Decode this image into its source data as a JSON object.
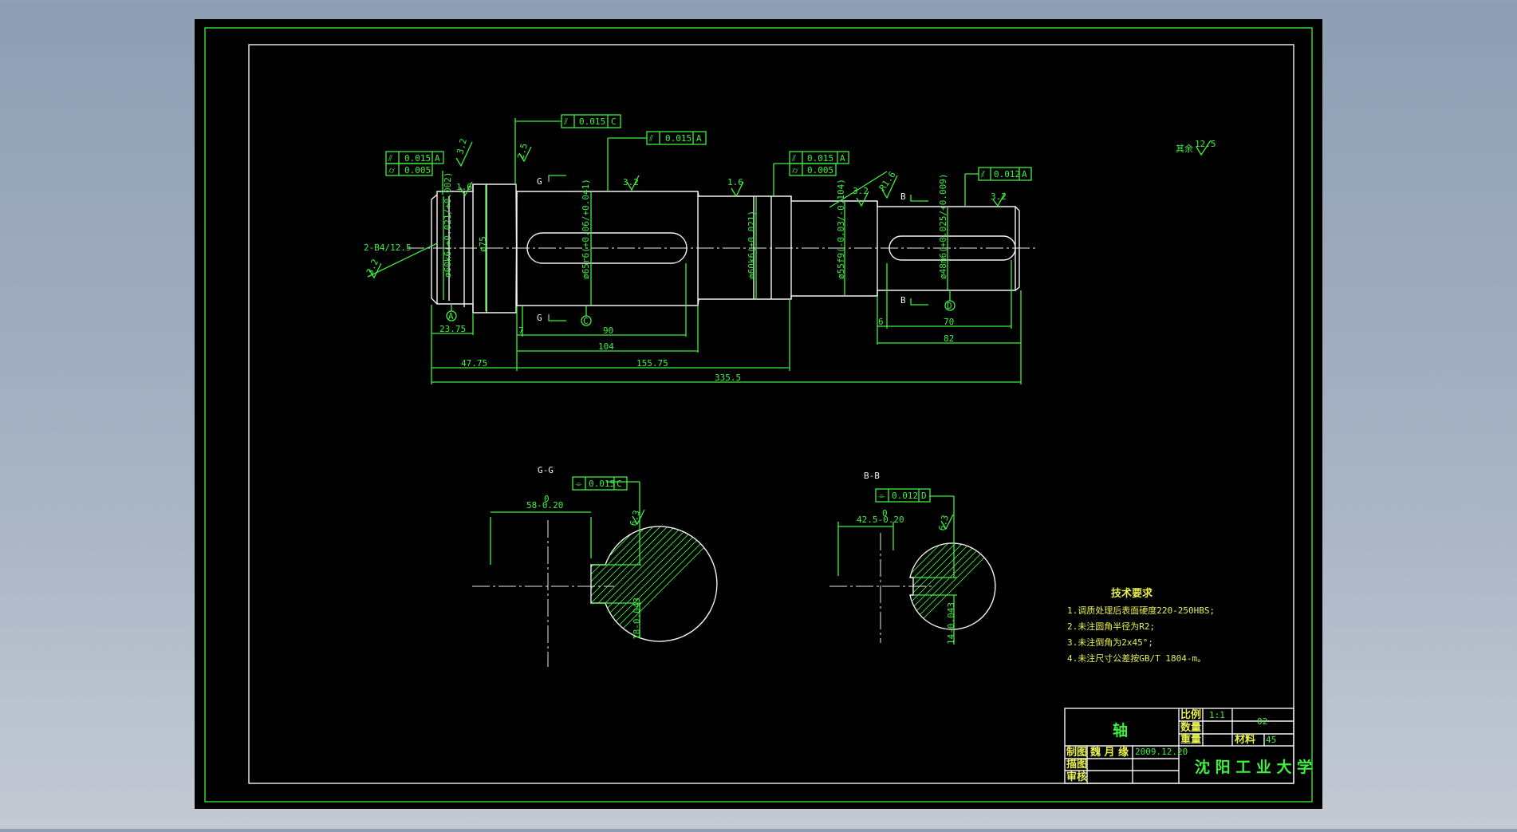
{
  "colors": {
    "sheet": "#000000",
    "line_green": "#3ef03e",
    "line_white": "#f2f2f2",
    "text_yellow": "#e8f050",
    "bg": "#a9b4c4"
  },
  "frames": {
    "top1": {
      "sym": "⫽",
      "val": "0.015",
      "ref": "A"
    },
    "top2": {
      "sym": "⌭",
      "val": "0.005"
    },
    "mid_c": {
      "sym": "⫽",
      "val": "0.015",
      "ref": "C"
    },
    "mid_a": {
      "sym": "⫽",
      "val": "0.015",
      "ref": "A"
    },
    "r1": {
      "sym": "⫽",
      "val": "0.015",
      "ref": "A"
    },
    "r2": {
      "sym": "⌭",
      "val": "0.005"
    },
    "r3": {
      "sym": "⫽",
      "val": "0.012",
      "ref": "A"
    },
    "gg": {
      "sym": "⌯",
      "val": "0.015",
      "ref": "C"
    },
    "bb": {
      "sym": "⌯",
      "val": "0.012",
      "ref": "D"
    }
  },
  "rough": {
    "r32a": "3.2",
    "r16a": "1.6",
    "r25": "2.5",
    "r32b": "3.2",
    "r16b": "1.6",
    "r32c": "3.2",
    "r16c": "R1.6",
    "r32d": "3.2",
    "r32e": "3.2",
    "r63a": "6.3",
    "r63b": "6.3",
    "r125": "12.5",
    "rest": "其余"
  },
  "dims": {
    "d60a": "ø60k6(+0.021/+0.002)",
    "d75": "ø75",
    "d65": "ø65r6(+0.06/+0.041)",
    "d60b": "ø60k6(+0.021)",
    "d55": "ø55f9(-0.03/-0.104)",
    "d48": "ø48m6(+0.025/+0.009)",
    "center": "2-B4/12.5",
    "l2375": "23.75",
    "l7": "7",
    "l90": "90",
    "l104": "104",
    "l4775": "47.75",
    "l15575": "155.75",
    "l3355": "335.5",
    "l6": "6",
    "l70": "70",
    "l82": "82",
    "w58": "58-0.20",
    "w58_top": "0",
    "w42": "42.5-0.20",
    "w42_top": "0",
    "k18": "18-0.043",
    "k18_top": "0",
    "k14": "14-0.043"
  },
  "datums": {
    "A": "A",
    "C": "C",
    "D": "D"
  },
  "sections": {
    "gg": "G-G",
    "bb": "B-B",
    "g_mark": "G",
    "b_mark": "B"
  },
  "requirements": {
    "title": "技术要求",
    "items": [
      "1.调质处理后表面硬度220-250HBS;",
      "2.未注圆角半径为R2;",
      "3.未注倒角为2x45°;",
      "4.未注尺寸公差按GB/T 1804-m。"
    ]
  },
  "title_block": {
    "part": "轴",
    "scale_label": "比例",
    "scale": "1:1",
    "count_label": "数量",
    "weight_label": "重量",
    "drawing_no": "02",
    "material_label": "材料",
    "material": "45",
    "drawn_label": "制图",
    "drawer": "魏 月 缘",
    "date": "2009.12.20",
    "check_label": "描图",
    "review_label": "审核",
    "school": "沈 阳 工 业 大 学"
  }
}
